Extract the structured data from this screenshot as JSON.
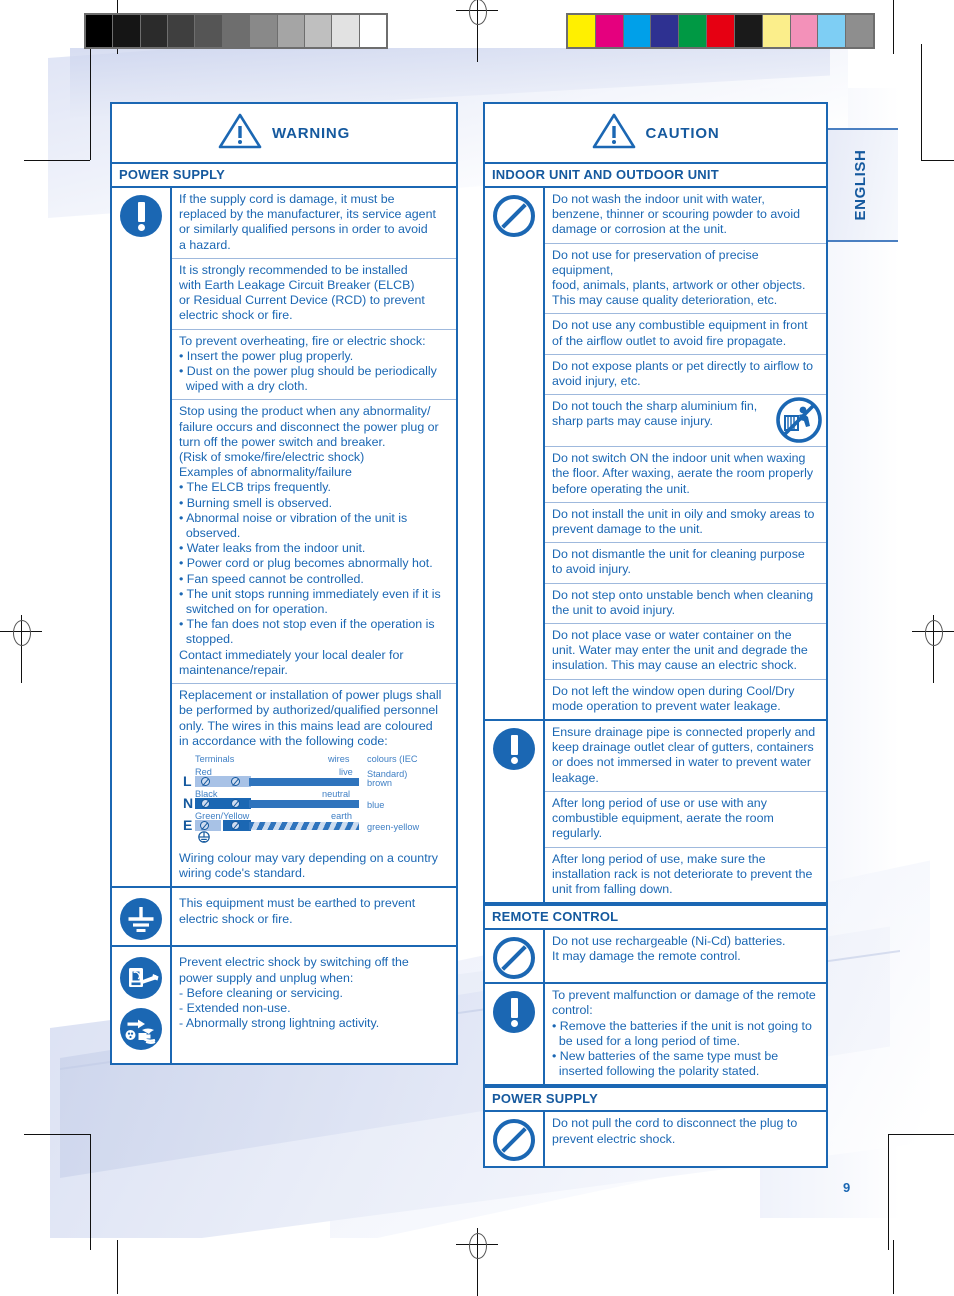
{
  "page": {
    "number": "9",
    "language_tab": "ENGLISH"
  },
  "calibration": {
    "grayscale": [
      "#000000",
      "#151515",
      "#2b2b2b",
      "#3f3f3f",
      "#555555",
      "#6e6e6e",
      "#898989",
      "#a5a5a5",
      "#bfbfbf",
      "#e2e2e2",
      "#ffffff"
    ],
    "colors": [
      "#fff000",
      "#e5007e",
      "#00a0e9",
      "#2e3191",
      "#009944",
      "#e60012",
      "#1a1a1a",
      "#fbee8b",
      "#f391b9",
      "#7ecef4",
      "#8e8e8e"
    ]
  },
  "left_column": {
    "header": {
      "icon": "warning-triangle-icon",
      "label": "WARNING"
    },
    "section_title": "POWER SUPPLY",
    "groups": [
      {
        "icons": [
          "mandatory-exclamation-icon"
        ],
        "rows": [
          {
            "lines": [
              "If the supply cord is damage, it must be",
              "replaced by the manufacturer, its service agent",
              "or similarly qualified persons in order to avoid",
              "a hazard."
            ]
          },
          {
            "lines": [
              "It is strongly recommended to be installed",
              "with Earth Leakage Circuit Breaker (ELCB)",
              "or Residual Current Device (RCD) to prevent",
              "electric shock or fire."
            ]
          },
          {
            "lines": [
              "To prevent overheating, fire or electric shock:",
              "• Insert the power plug properly.",
              "• Dust on the power plug should be periodically",
              "  wiped with a dry cloth."
            ]
          },
          {
            "lines": [
              "Stop using the product when any abnormality/",
              "failure occurs and disconnect the power plug or",
              "turn off the power switch and breaker.",
              "(Risk of smoke/fire/electric shock)",
              "Examples of abnormality/failure",
              "• The ELCB trips frequently.",
              "• Burning smell is observed.",
              "• Abnormal noise or vibration of the unit is",
              "  observed.",
              "• Water leaks from the indoor unit.",
              "• Power cord or plug becomes abnormally hot.",
              "• Fan speed cannot be controlled.",
              "• The unit stops running immediately even if it is",
              "  switched on for operation.",
              "• The fan does not stop even if the operation is",
              "  stopped.",
              "Contact immediately your local dealer for",
              "maintenance/repair."
            ]
          },
          {
            "lines": [
              "Replacement or installation of power plugs shall",
              "be performed by authorized/qualified personnel",
              "only. The wires in this mains lead are coloured",
              "in accordance with the following code:"
            ],
            "wiring_diagram": {
              "col_headers": [
                "Terminals",
                "wires",
                "colours (IEC Standard)"
              ],
              "entries": [
                {
                  "letter": "L",
                  "terminal": "Red",
                  "wire": "live",
                  "colour": "brown"
                },
                {
                  "letter": "N",
                  "terminal": "Black",
                  "wire": "neutral",
                  "colour": "blue"
                },
                {
                  "letter": "E",
                  "terminal": "Green/Yellow",
                  "wire": "earth",
                  "colour": "green-yellow"
                }
              ]
            },
            "footer_lines": [
              "Wiring colour may vary depending on a country",
              "wiring code's standard."
            ]
          }
        ]
      },
      {
        "icons": [
          "earth-ground-icon"
        ],
        "rows": [
          {
            "lines": [
              "This equipment must be earthed to prevent",
              "electric shock or fire."
            ]
          }
        ]
      },
      {
        "icons": [
          "switch-off-power-icon",
          "unplug-icon"
        ],
        "rows": [
          {
            "lines": [
              "Prevent electric shock by switching off the",
              "power supply and unplug when:",
              "- Before cleaning or servicing.",
              "- Extended non-use.",
              "- Abnormally strong lightning activity."
            ]
          }
        ]
      }
    ]
  },
  "right_column": {
    "header": {
      "icon": "caution-triangle-icon",
      "label": "CAUTION"
    },
    "sections": [
      {
        "title": "INDOOR UNIT AND OUTDOOR UNIT",
        "groups": [
          {
            "icons": [
              "prohibition-icon"
            ],
            "rows": [
              {
                "lines": [
                  "Do not wash the indoor unit with water,",
                  "benzene, thinner or scouring powder to avoid",
                  "damage or corrosion at the unit."
                ]
              },
              {
                "lines": [
                  "Do not use for preservation of precise equipment,",
                  "food, animals, plants, artwork or other objects.",
                  "This may cause quality deterioration, etc."
                ]
              },
              {
                "lines": [
                  "Do not use any combustible equipment in front",
                  "of the airflow outlet to avoid fire propagate."
                ]
              },
              {
                "lines": [
                  "Do not expose plants or pet directly to airflow to",
                  "avoid injury, etc."
                ]
              },
              {
                "lines": [
                  "Do not touch the sharp aluminium fin,",
                  "sharp parts may cause injury."
                ],
                "badge": "no-touch-sharp-fin-icon"
              },
              {
                "lines": [
                  "Do not switch ON the indoor unit when waxing",
                  "the floor. After waxing, aerate the room properly",
                  "before operating the unit."
                ]
              },
              {
                "lines": [
                  "Do not install the unit in oily and smoky areas to",
                  "prevent damage to the unit."
                ]
              },
              {
                "lines": [
                  "Do not dismantle the unit for cleaning purpose",
                  "to avoid injury."
                ]
              },
              {
                "lines": [
                  "Do not step onto unstable bench when cleaning",
                  "the unit to avoid injury."
                ]
              },
              {
                "lines": [
                  "Do not place vase or water container on the",
                  "unit. Water may enter the unit and degrade the",
                  "insulation. This may cause an electric shock."
                ]
              },
              {
                "lines": [
                  "Do not left the window open during Cool/Dry",
                  "mode operation to prevent water leakage."
                ]
              }
            ]
          },
          {
            "icons": [
              "mandatory-exclamation-icon"
            ],
            "rows": [
              {
                "lines": [
                  "Ensure drainage pipe is connected properly and",
                  "keep drainage outlet clear of gutters, containers",
                  "or does not immersed in water to prevent water",
                  "leakage."
                ]
              },
              {
                "lines": [
                  "After long period of use or use with any",
                  "combustible equipment, aerate the room",
                  "regularly."
                ]
              },
              {
                "lines": [
                  "After long period of use, make sure the",
                  "installation rack is not deteriorate to prevent the",
                  "unit from falling down."
                ]
              }
            ]
          }
        ]
      },
      {
        "title": "REMOTE CONTROL",
        "groups": [
          {
            "icons": [
              "prohibition-icon"
            ],
            "rows": [
              {
                "lines": [
                  "Do not use rechargeable (Ni-Cd) batteries.",
                  "It may damage the remote control."
                ]
              }
            ]
          },
          {
            "icons": [
              "mandatory-exclamation-icon"
            ],
            "rows": [
              {
                "lines": [
                  "To prevent malfunction or damage of the remote",
                  "control:",
                  "• Remove the batteries if the unit is not going to",
                  "  be used for a long period of time.",
                  "• New batteries of the same type must be",
                  "  inserted following the polarity stated."
                ]
              }
            ]
          }
        ]
      },
      {
        "title": "POWER SUPPLY",
        "groups": [
          {
            "icons": [
              "prohibition-icon"
            ],
            "rows": [
              {
                "lines": [
                  "Do not pull the cord to disconnect the plug to",
                  "prevent electric shock."
                ]
              }
            ]
          }
        ]
      }
    ]
  },
  "theme": {
    "accent_blue": "#1b67b3",
    "text_blue": "#15599e",
    "rule_blue": "#9fb9dd"
  }
}
